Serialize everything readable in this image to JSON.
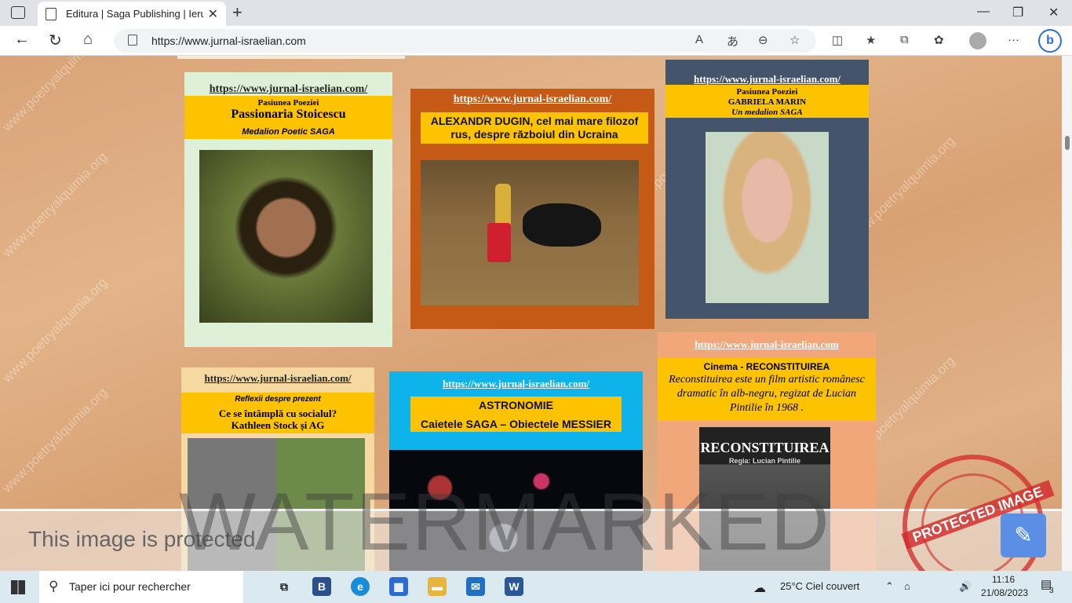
{
  "browser": {
    "tab_title": "Editura | Saga Publishing | Ierusal",
    "url": "https://www.jurnal-israelian.com"
  },
  "cards": {
    "passionaria": {
      "url": "https://www.jurnal-israelian.com/",
      "line1": "Pasiunea Poeziei",
      "line2": "Passionaria Stoicescu",
      "line3": "Medalion Poetic SAGA"
    },
    "dugin": {
      "url": "https://www.jurnal-israelian.com/",
      "headline1": "ALEXANDR DUGIN, cel mai mare filozof",
      "headline2": "rus, despre războiul din Ucraina"
    },
    "gabriela": {
      "url": "https://www.jurnal-israelian.com/",
      "line1": "Pasiunea Poeziei",
      "line2": "GABRIELA MARIN",
      "line3": "Un medalion SAGA"
    },
    "reflexii": {
      "url": "https://www.jurnal-israelian.com/",
      "line1": "Reflexii despre prezent",
      "line2": "Ce se întâmplă cu socialul?",
      "line3": "Kathleen Stock și AG"
    },
    "astronomie": {
      "url": "https://www.jurnal-israelian.com/",
      "line1": "ASTRONOMIE",
      "line2": "Caietele SAGA – Obiectele MESSIER"
    },
    "reconstituirea": {
      "url": "https://www.jurnal-israelian.com",
      "line1": "Cinema - RECONSTITUIREA",
      "line2": "Reconstituirea este un film artistic românesc dramatic în alb-negru, regizat de Lucian Pintilie în 1968 .",
      "poster_title": "RECONSTITUIREA",
      "poster_sub": "Regia: Lucian Pintilie"
    }
  },
  "watermark": {
    "site": "www.poetryalquimia.org",
    "big": "WATERMARKED",
    "protected_text": "This image is protected",
    "stamp": "PROTECTED IMAGE"
  },
  "taskbar": {
    "search_placeholder": "Taper ici pour rechercher",
    "weather": "25°C  Ciel couvert",
    "time": "11:16",
    "date": "21/08/2023",
    "notifications": "3"
  }
}
